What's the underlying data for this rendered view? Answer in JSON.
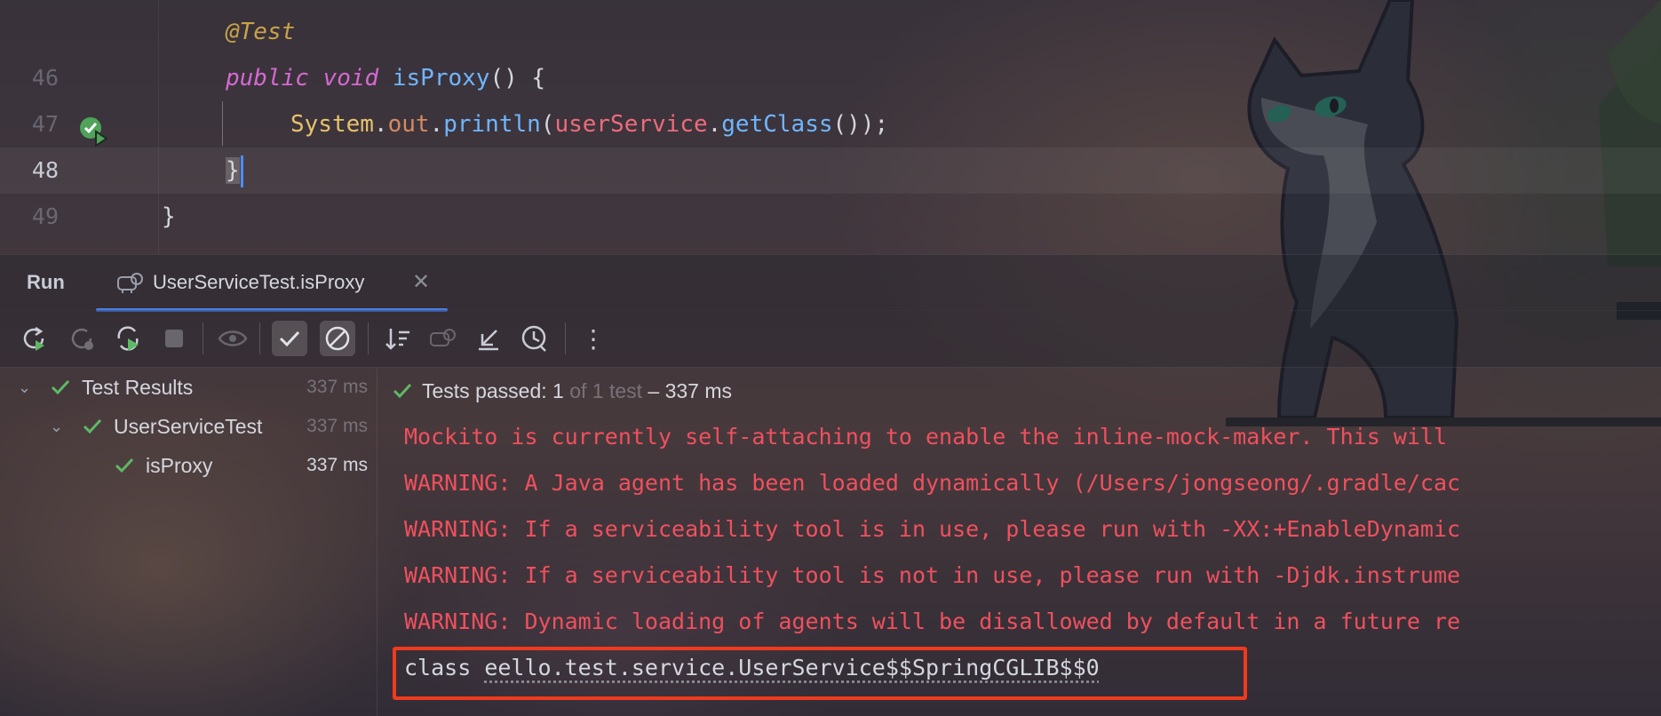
{
  "editor": {
    "lines": [
      {
        "number": "",
        "annotation": "@Test"
      },
      {
        "number": "46",
        "kw1": "public",
        "kw2": "void",
        "method": "isProxy",
        "rest": "() {"
      },
      {
        "number": "47",
        "cls": "System",
        "field": "out",
        "fn": "println",
        "var": "userService",
        "fn2": "getClass",
        "tail": "());"
      },
      {
        "number": "48",
        "brace": "}"
      },
      {
        "number": "49",
        "brace": "}"
      }
    ]
  },
  "tabs": {
    "run_label": "Run",
    "test_tab_label": "UserServiceTest.isProxy",
    "close_glyph": "✕"
  },
  "toolbar": {
    "buttons": [
      "rerun-icon",
      "rerun-failed-icon",
      "toggle-auto-test-icon",
      "stop-icon",
      "show-passed-icon",
      "show-ignored-icon",
      "sort-icon",
      "import-tests-icon",
      "collapse-icon",
      "history-icon",
      "more-icon"
    ],
    "more_glyph": "⋮"
  },
  "tree": {
    "rows": [
      {
        "label": "Test Results",
        "duration": "337 ms"
      },
      {
        "label": "UserServiceTest",
        "duration": "337 ms"
      },
      {
        "label": "isProxy",
        "duration": "337 ms"
      }
    ]
  },
  "console": {
    "status_passed": "Tests passed: 1",
    "status_of": "of 1 test",
    "status_time": "– 337 ms",
    "lines": [
      "Mockito is currently self-attaching to enable the inline-mock-maker. This will",
      "WARNING: A Java agent has been loaded dynamically (/Users/jongseong/.gradle/cac",
      "WARNING: If a serviceability tool is in use, please run with -XX:+EnableDynamic",
      "WARNING: If a serviceability tool is not in use, please run with -Djdk.instrume",
      "WARNING: Dynamic loading of agents will be disallowed by default in a future re"
    ],
    "result_prefix": "class ",
    "result_class": "eello.test.service.UserService$$SpringCGLIB$$0"
  },
  "colors": {
    "error_text": "#f0505e",
    "pass_green": "#5fb865",
    "accent": "#4c7fe0",
    "highlight_box": "#f03a1e"
  }
}
